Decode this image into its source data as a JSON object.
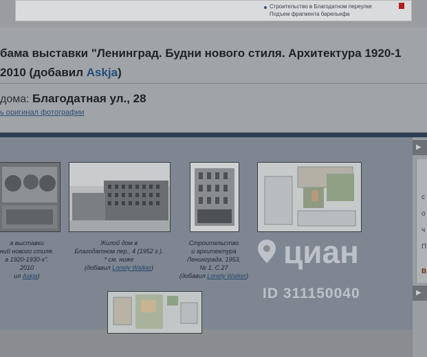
{
  "top": {
    "caption_line1": "Строительство в Благодатном переулке",
    "caption_line2": "Подъем фрагмента барельефа"
  },
  "heading": {
    "line1": "бама выставки \"Ленинград. Будни нового стиля. Архитектура 1920-1",
    "line2_prefix": "2010  (добавил ",
    "author": "Askja",
    "line2_suffix": ")"
  },
  "address": {
    "label": "дома: ",
    "value": "Благодатная ул., 28"
  },
  "original_link": "ь оригинал фотографии",
  "gallery": {
    "items": [
      {
        "lines": [
          "а выставки",
          "ний нового стиля.",
          "а 1920-1930-х\".",
          "2010"
        ],
        "adder_prefix": "ил ",
        "adder": "Askja",
        "adder_suffix": ")"
      },
      {
        "lines": [
          "Жилой дом в",
          "Благодатном пер., 4 (1952 г.).",
          "* см. ниже"
        ],
        "adder_prefix": "(добавил ",
        "adder": "Lonely Walker",
        "adder_suffix": ")"
      },
      {
        "lines": [
          "Строительство",
          "и архитектура",
          "Ленинграда. 1953.",
          "№ 1. С.27"
        ],
        "adder_prefix": "(добавил ",
        "adder": "Lonely Walker",
        "adder_suffix": ")"
      }
    ]
  },
  "sidebar": {
    "letters": [
      "с",
      "о",
      "ч",
      "П",
      "В"
    ],
    "arrow": "▶"
  },
  "watermark": {
    "name": "циан",
    "id": "ID 311150040"
  },
  "colors": {
    "page_dim": "#a0a3a7",
    "link": "#244e7d",
    "accent_red": "#b21d1d"
  }
}
